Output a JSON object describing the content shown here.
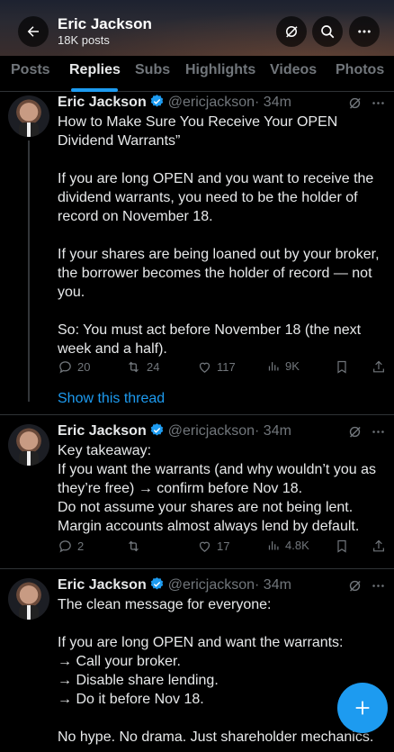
{
  "header": {
    "title": "Eric Jackson",
    "subtitle": "18K posts"
  },
  "tabs": [
    {
      "label": "Posts"
    },
    {
      "label": "Replies"
    },
    {
      "label": "Subs"
    },
    {
      "label": "Highlights"
    },
    {
      "label": "Videos"
    },
    {
      "label": "Photos"
    }
  ],
  "active_tab": "Replies",
  "posts": [
    {
      "name": "Eric Jackson",
      "handle": "@ericjackson",
      "time": "· 34m",
      "lines": [
        "How to Make Sure You Receive Your OPEN",
        "Dividend Warrants”",
        "",
        "If you are long OPEN and you want to receive the",
        "dividend warrants, you need to be the holder of",
        "record on November 18.",
        "",
        "If your shares are being loaned out by your broker,",
        "the borrower becomes the holder of record — not",
        "you.",
        "",
        "So: You must act before November 18 (the next",
        "week and a half)."
      ],
      "replies": "20",
      "reposts": "24",
      "likes": "117",
      "views": "9K"
    },
    {
      "name": "Eric Jackson",
      "handle": "@ericjackson",
      "time": "· 34m",
      "lines": [
        "Key takeaway:",
        "If you want the warrants (and why wouldn’t you as",
        "they’re free) → confirm before Nov 18.",
        "Do not assume your shares are not being lent.",
        "Margin accounts almost always lend by default."
      ],
      "replies": "2",
      "reposts": "",
      "likes": "17",
      "views": "4.8K"
    },
    {
      "name": "Eric Jackson",
      "handle": "@ericjackson",
      "time": "· 34m",
      "lines": [
        "The clean message for everyone:",
        "",
        "If you are long OPEN and want the warrants:",
        "→ Call your broker.",
        "→ Disable share lending.",
        "→ Do it before Nov 18.",
        "",
        "No hype. No drama. Just shareholder mechanics."
      ]
    }
  ],
  "show_thread": "Show this thread",
  "colors": {
    "accent": "#1d9bf0",
    "muted": "#71767b",
    "text": "#e7e9ea",
    "background": "#000000"
  },
  "icons": [
    "back-arrow-icon",
    "grok-icon",
    "search-icon",
    "more-icon",
    "verified-badge-icon",
    "reply-icon",
    "repost-icon",
    "like-icon",
    "views-icon",
    "bookmark-icon",
    "share-icon",
    "compose-plus-icon"
  ]
}
